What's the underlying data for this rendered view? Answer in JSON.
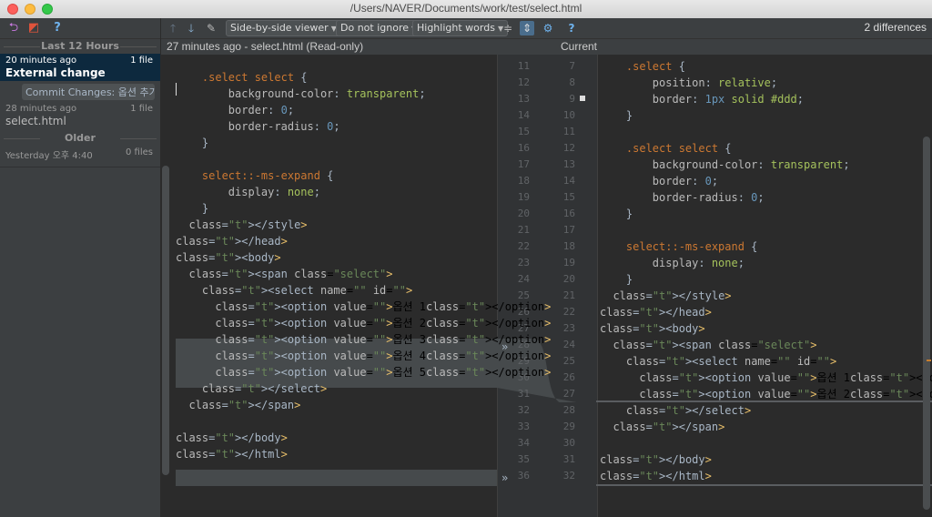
{
  "window": {
    "title": "/Users/NAVER/Documents/work/test/select.html"
  },
  "sidebar": {
    "section_recent": "Last 12 Hours",
    "section_older": "Older",
    "revisions": [
      {
        "time": "20 minutes ago",
        "count": "1 file",
        "label": "External change",
        "selected": true
      },
      {
        "tag": "Commit Changes: 옵션 추가"
      },
      {
        "time": "28 minutes ago",
        "count": "1 file",
        "label": "select.html"
      },
      {
        "time": "Yesterday 오후 4:40",
        "count": "0 files"
      }
    ]
  },
  "toolbar": {
    "viewer": "Side-by-side viewer",
    "ignore": "Do not ignore",
    "highlight": "Highlight words",
    "differences": "2 differences"
  },
  "header": {
    "left": "27 minutes ago - select.html (Read-only)",
    "right": "Current"
  },
  "left_lines": [
    {
      "n": "11",
      "code": ""
    },
    {
      "n": "12",
      "code": "    .select select {"
    },
    {
      "n": "13",
      "code": "        background-color: transparent;"
    },
    {
      "n": "14",
      "code": "        border: 0;"
    },
    {
      "n": "15",
      "code": "        border-radius: 0;"
    },
    {
      "n": "16",
      "code": "    }"
    },
    {
      "n": "17",
      "code": ""
    },
    {
      "n": "18",
      "code": "    select::-ms-expand {"
    },
    {
      "n": "19",
      "code": "        display: none;"
    },
    {
      "n": "20",
      "code": "    }"
    },
    {
      "n": "21",
      "code": "  </style>"
    },
    {
      "n": "22",
      "code": "</head>"
    },
    {
      "n": "23",
      "code": "<body>"
    },
    {
      "n": "24",
      "code": "  <span class=\"select\">"
    },
    {
      "n": "25",
      "code": "    <select name=\"\" id=\"\">"
    },
    {
      "n": "26",
      "code": "      <option value=\"\">옵션 1</option>"
    },
    {
      "n": "27",
      "code": "      <option value=\"\">옵션 2</option>"
    },
    {
      "n": "28",
      "code": "      <option value=\"\">옵션 3</option>"
    },
    {
      "n": "29",
      "code": "      <option value=\"\">옵션 4</option>"
    },
    {
      "n": "30",
      "code": "      <option value=\"\">옵션 5</option>"
    },
    {
      "n": "31",
      "code": "    </select>"
    },
    {
      "n": "32",
      "code": "  </span>"
    },
    {
      "n": "33",
      "code": ""
    },
    {
      "n": "34",
      "code": "</body>"
    },
    {
      "n": "35",
      "code": "</html>"
    },
    {
      "n": "36",
      "code": ""
    }
  ],
  "right_lines": [
    {
      "n": "7",
      "code": "    .select {"
    },
    {
      "n": "8",
      "code": "        position: relative;"
    },
    {
      "n": "9",
      "code": "        border: 1px solid #ddd;"
    },
    {
      "n": "10",
      "code": "    }"
    },
    {
      "n": "11",
      "code": ""
    },
    {
      "n": "12",
      "code": "    .select select {"
    },
    {
      "n": "13",
      "code": "        background-color: transparent;"
    },
    {
      "n": "14",
      "code": "        border: 0;"
    },
    {
      "n": "15",
      "code": "        border-radius: 0;"
    },
    {
      "n": "16",
      "code": "    }"
    },
    {
      "n": "17",
      "code": ""
    },
    {
      "n": "18",
      "code": "    select::-ms-expand {"
    },
    {
      "n": "19",
      "code": "        display: none;"
    },
    {
      "n": "20",
      "code": "    }"
    },
    {
      "n": "21",
      "code": "  </style>"
    },
    {
      "n": "22",
      "code": "</head>"
    },
    {
      "n": "23",
      "code": "<body>"
    },
    {
      "n": "24",
      "code": "  <span class=\"select\">"
    },
    {
      "n": "25",
      "code": "    <select name=\"\" id=\"\">"
    },
    {
      "n": "26",
      "code": "      <option value=\"\">옵션 1</option>"
    },
    {
      "n": "27",
      "code": "      <option value=\"\">옵션 2</option>"
    },
    {
      "n": "28",
      "code": "    </select>"
    },
    {
      "n": "29",
      "code": "  </span>"
    },
    {
      "n": "30",
      "code": ""
    },
    {
      "n": "31",
      "code": "</body>"
    },
    {
      "n": "32",
      "code": "</html>"
    }
  ]
}
